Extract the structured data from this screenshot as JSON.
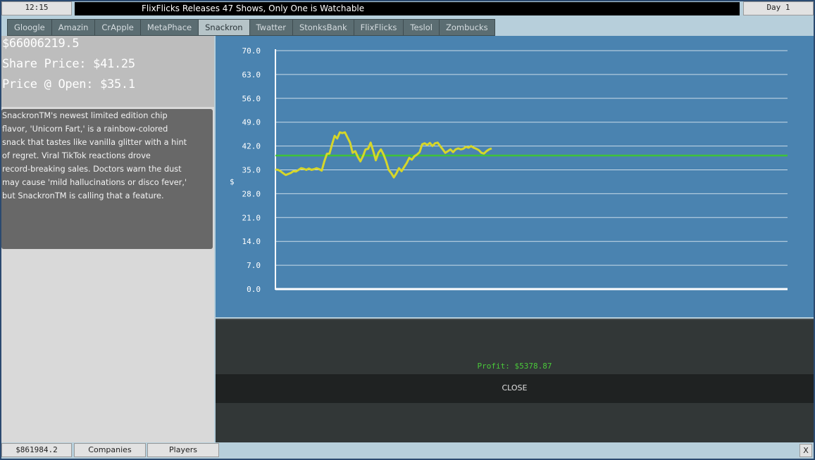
{
  "header": {
    "clock": "12:15",
    "ticker": "FlixFlicks Releases 47 Shows, Only One is Watchable",
    "day": "Day 1"
  },
  "tabs": [
    {
      "label": "Gloogle",
      "active": false
    },
    {
      "label": "Amazin",
      "active": false
    },
    {
      "label": "CrApple",
      "active": false
    },
    {
      "label": "MetaPhace",
      "active": false
    },
    {
      "label": "Snackron",
      "active": true
    },
    {
      "label": "Twatter",
      "active": false
    },
    {
      "label": "StonksBank",
      "active": false
    },
    {
      "label": "FlixFlicks",
      "active": false
    },
    {
      "label": "Teslol",
      "active": false
    },
    {
      "label": "Zombucks",
      "active": false
    }
  ],
  "company": {
    "market_cap": "$66006219.5",
    "share_price": "Share Price: $41.25",
    "open_price": "Price @ Open: $35.1",
    "news_lines": [
      "SnackronTM's newest limited edition chip",
      "flavor, 'Unicorn Fart,' is a rainbow-colored",
      "snack that tastes like vanilla glitter with a hint",
      "of regret. Viral TikTok reactions drove",
      "record-breaking sales. Doctors warn the dust",
      "may cause 'mild hallucinations or disco fever,'",
      "but SnackronTM is calling that a feature."
    ]
  },
  "chart_data": {
    "type": "line",
    "title": "",
    "xlabel": "",
    "ylabel": "$",
    "ylim": [
      0,
      70
    ],
    "yticks": [
      "0.0",
      "7.0",
      "14.0",
      "21.0",
      "28.0",
      "35.0",
      "42.0",
      "49.0",
      "56.0",
      "63.0",
      "70.0"
    ],
    "grid": true,
    "reference_line": {
      "value": 39.2,
      "color": "#3fc23a"
    },
    "series": [
      {
        "color": "#d6d62a",
        "values": [
          35.1,
          35.0,
          34.6,
          34.0,
          33.5,
          33.8,
          34.1,
          34.6,
          34.5,
          35.0,
          35.5,
          35.3,
          35.0,
          35.4,
          35.0,
          35.2,
          35.5,
          35.2,
          34.8,
          37.5,
          39.7,
          39.8,
          42.5,
          45.0,
          44.2,
          46.0,
          45.8,
          46.0,
          44.5,
          43.0,
          40.0,
          40.5,
          38.8,
          37.5,
          39.0,
          41.0,
          41.2,
          43.0,
          40.5,
          37.8,
          40.0,
          41.0,
          39.5,
          37.5,
          35.0,
          34.0,
          32.8,
          34.0,
          35.5,
          34.6,
          35.8,
          37.0,
          38.5,
          38.0,
          39.0,
          39.5,
          40.2,
          42.5,
          42.8,
          42.3,
          42.9,
          42.0,
          42.8,
          43.0,
          42.0,
          41.0,
          40.0,
          40.5,
          41.0,
          40.2,
          41.0,
          41.3,
          41.0,
          41.2,
          41.8,
          41.5,
          42.0,
          41.5,
          41.2,
          40.8,
          40.0,
          39.8,
          40.5,
          41.0,
          41.3
        ]
      }
    ]
  },
  "trade": {
    "profit": "Profit: $5378.87",
    "close_label": "CLOSE"
  },
  "footer": {
    "money": "$861984.2",
    "companies_label": "Companies",
    "players_label": "Players",
    "exit_label": "X"
  }
}
